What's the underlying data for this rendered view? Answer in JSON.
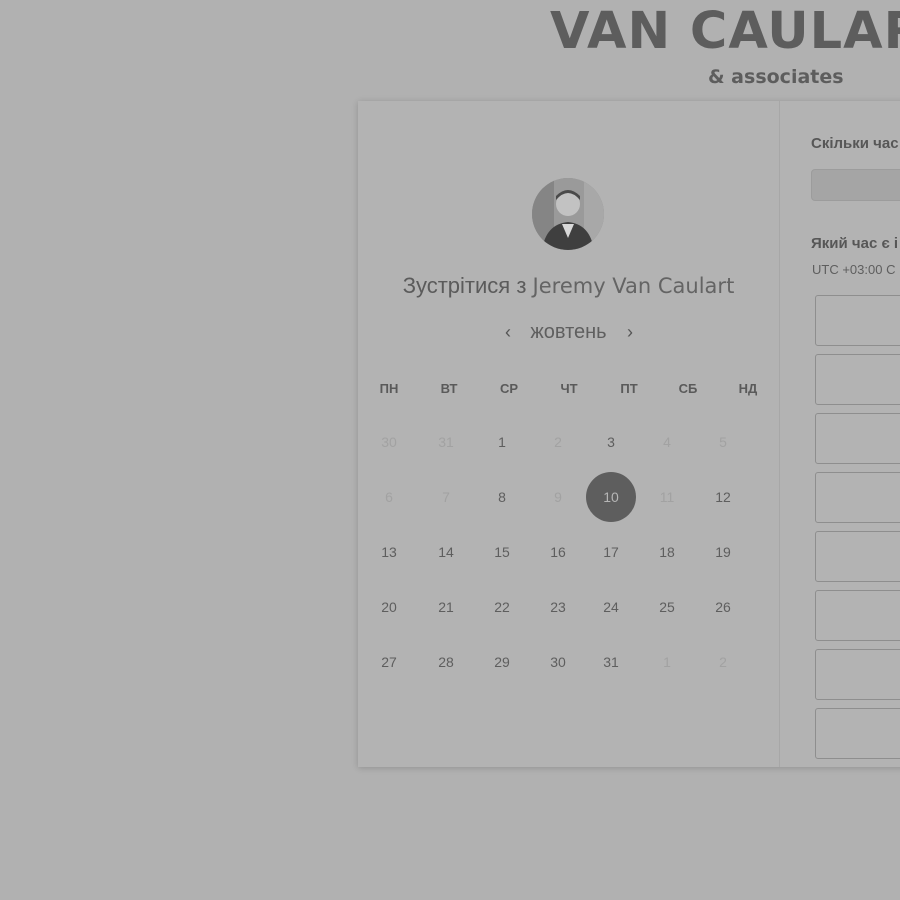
{
  "brand": {
    "name": "VAN CAULART",
    "tagline": "& associates"
  },
  "profile": {
    "avatar_icon": "person-photo",
    "meet_prefix": "Зустрітися з",
    "host_name": "Jeremy Van Caulart"
  },
  "calendar": {
    "month": "жовтень",
    "prev_icon": "chevron-left-icon",
    "next_icon": "chevron-right-icon",
    "weekdays": [
      "ПН",
      "ВТ",
      "СР",
      "ЧТ",
      "ПТ",
      "СБ",
      "НД"
    ],
    "weeks": [
      [
        {
          "d": "30",
          "s": "dim"
        },
        {
          "d": "31",
          "s": "dim"
        },
        {
          "d": "1",
          "s": ""
        },
        {
          "d": "2",
          "s": "dim"
        },
        {
          "d": "3",
          "s": ""
        },
        {
          "d": "4",
          "s": "dim"
        },
        {
          "d": "5",
          "s": "dim"
        }
      ],
      [
        {
          "d": "6",
          "s": "dim"
        },
        {
          "d": "7",
          "s": "dim"
        },
        {
          "d": "8",
          "s": ""
        },
        {
          "d": "9",
          "s": "dim"
        },
        {
          "d": "10",
          "s": "sel"
        },
        {
          "d": "11",
          "s": "dim"
        },
        {
          "d": "12",
          "s": ""
        }
      ],
      [
        {
          "d": "13",
          "s": ""
        },
        {
          "d": "14",
          "s": ""
        },
        {
          "d": "15",
          "s": ""
        },
        {
          "d": "16",
          "s": ""
        },
        {
          "d": "17",
          "s": ""
        },
        {
          "d": "18",
          "s": ""
        },
        {
          "d": "19",
          "s": ""
        }
      ],
      [
        {
          "d": "20",
          "s": ""
        },
        {
          "d": "21",
          "s": ""
        },
        {
          "d": "22",
          "s": ""
        },
        {
          "d": "23",
          "s": ""
        },
        {
          "d": "24",
          "s": ""
        },
        {
          "d": "25",
          "s": ""
        },
        {
          "d": "26",
          "s": ""
        }
      ],
      [
        {
          "d": "27",
          "s": ""
        },
        {
          "d": "28",
          "s": ""
        },
        {
          "d": "29",
          "s": ""
        },
        {
          "d": "30",
          "s": ""
        },
        {
          "d": "31",
          "s": ""
        },
        {
          "d": "1",
          "s": "dim"
        },
        {
          "d": "2",
          "s": "dim"
        }
      ]
    ],
    "selected_day": "10"
  },
  "booking": {
    "duration_label": "Скільки час",
    "duration_value": "",
    "time_label": "Який час є і",
    "timezone": "UTC +03:00 C",
    "slots": [
      "",
      "",
      "",
      "",
      "",
      "",
      "",
      ""
    ]
  }
}
